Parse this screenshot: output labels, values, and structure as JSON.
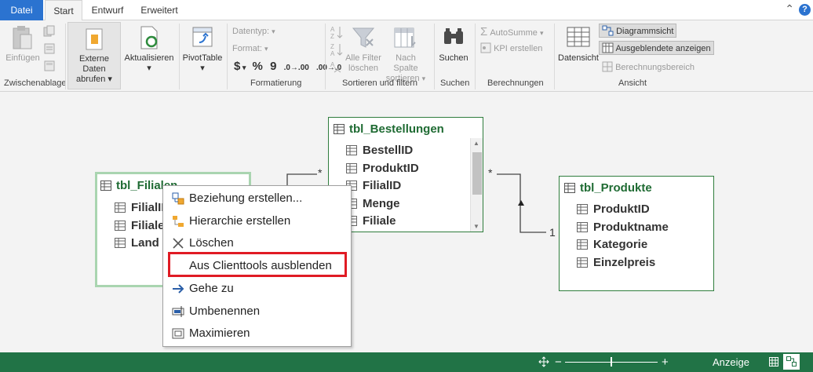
{
  "tabs": {
    "file": "Datei",
    "start": "Start",
    "entwurf": "Entwurf",
    "erweitert": "Erweitert"
  },
  "ribbon": {
    "einfuegen": "Einfügen",
    "externe_daten_1": "Externe Daten",
    "externe_daten_2": "abrufen",
    "aktualisieren": "Aktualisieren",
    "pivottable": "PivotTable",
    "datentyp": "Datentyp:",
    "format": "Format:",
    "currency": "$",
    "percent": "%",
    "thousands": "9",
    "inc_dec": ".0→.00",
    "dec_dec": ".00→.0",
    "alle_filter_1": "Alle Filter",
    "alle_filter_2": "löschen",
    "nach_spalte_1": "Nach Spalte",
    "nach_spalte_2": "sortieren",
    "suchen": "Suchen",
    "autosumme": "AutoSumme",
    "kpi": "KPI erstellen",
    "datensicht": "Datensicht",
    "diagrammsicht": "Diagrammsicht",
    "ausgeblendete": "Ausgeblendete anzeigen",
    "berechnungsbereich": "Berechnungsbereich",
    "groups": {
      "zwischenablage": "Zwischenablage",
      "formatierung": "Formatierung",
      "sortieren": "Sortieren und filtern",
      "suchen": "Suchen",
      "berechnungen": "Berechnungen",
      "ansicht": "Ansicht"
    }
  },
  "tables": {
    "filialen": {
      "title": "tbl_Filialen",
      "title_visible": "tbl_Filialen",
      "fields": [
        "FilialID",
        "Filiale",
        "Land"
      ]
    },
    "bestellungen": {
      "title": "tbl_Bestellungen",
      "fields": [
        "BestellID",
        "ProduktID",
        "FilialID",
        "Menge",
        "Filiale"
      ]
    },
    "produkte": {
      "title": "tbl_Produkte",
      "fields": [
        "ProduktID",
        "Produktname",
        "Kategorie",
        "Einzelpreis"
      ]
    }
  },
  "relations": {
    "many_1": "*",
    "many_2": "*",
    "one": "1"
  },
  "context_menu": {
    "items": [
      {
        "label": "Beziehung erstellen...",
        "icon": "relationship-icon"
      },
      {
        "label": "Hierarchie erstellen",
        "icon": "hierarchy-icon"
      },
      {
        "label": "Löschen",
        "icon": "delete-icon"
      },
      {
        "label": "Aus Clienttools ausblenden",
        "icon": ""
      },
      {
        "label": "Gehe zu",
        "icon": "arrow-right-icon"
      },
      {
        "label": "Umbenennen",
        "icon": "rename-icon"
      },
      {
        "label": "Maximieren",
        "icon": "maximize-icon"
      }
    ],
    "highlighted_index": 3
  },
  "status": {
    "anzeige": "Anzeige",
    "zoom_minus": "−",
    "zoom_plus": "+"
  },
  "colors": {
    "accent_blue": "#2b73d0",
    "status_green": "#217346",
    "table_title_green": "#1f6b33",
    "highlight_red": "#e01b24"
  }
}
